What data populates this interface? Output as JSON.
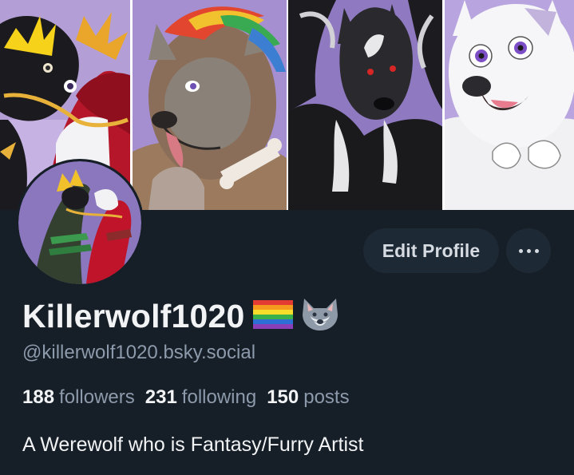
{
  "banner": {
    "panels": [
      {
        "icon": "dragon-character-art"
      },
      {
        "icon": "grey-wolf-character-art"
      },
      {
        "icon": "black-wolf-character-art"
      },
      {
        "icon": "white-wolf-character-art"
      }
    ]
  },
  "avatar": {
    "icon": "avatar-dragon-couple-art"
  },
  "actions": {
    "edit_profile_label": "Edit Profile",
    "more_icon": "ellipsis-icon"
  },
  "profile": {
    "display_name": "Killerwolf1020",
    "name_emojis": [
      "rainbow-flag-emoji",
      "wolf-face-emoji"
    ],
    "handle": "@killerwolf1020.bsky.social",
    "stats": {
      "followers_count": "188",
      "followers_label": "followers",
      "following_count": "231",
      "following_label": "following",
      "posts_count": "150",
      "posts_label": "posts"
    },
    "bio": "A Werewolf who is Fantasy/Furry Artist"
  },
  "colors": {
    "background": "#161e27",
    "button_bg": "#1e2936",
    "text_primary": "#f1f3f5",
    "text_secondary": "#8d9aab",
    "banner_purple": "#a58fd0"
  }
}
